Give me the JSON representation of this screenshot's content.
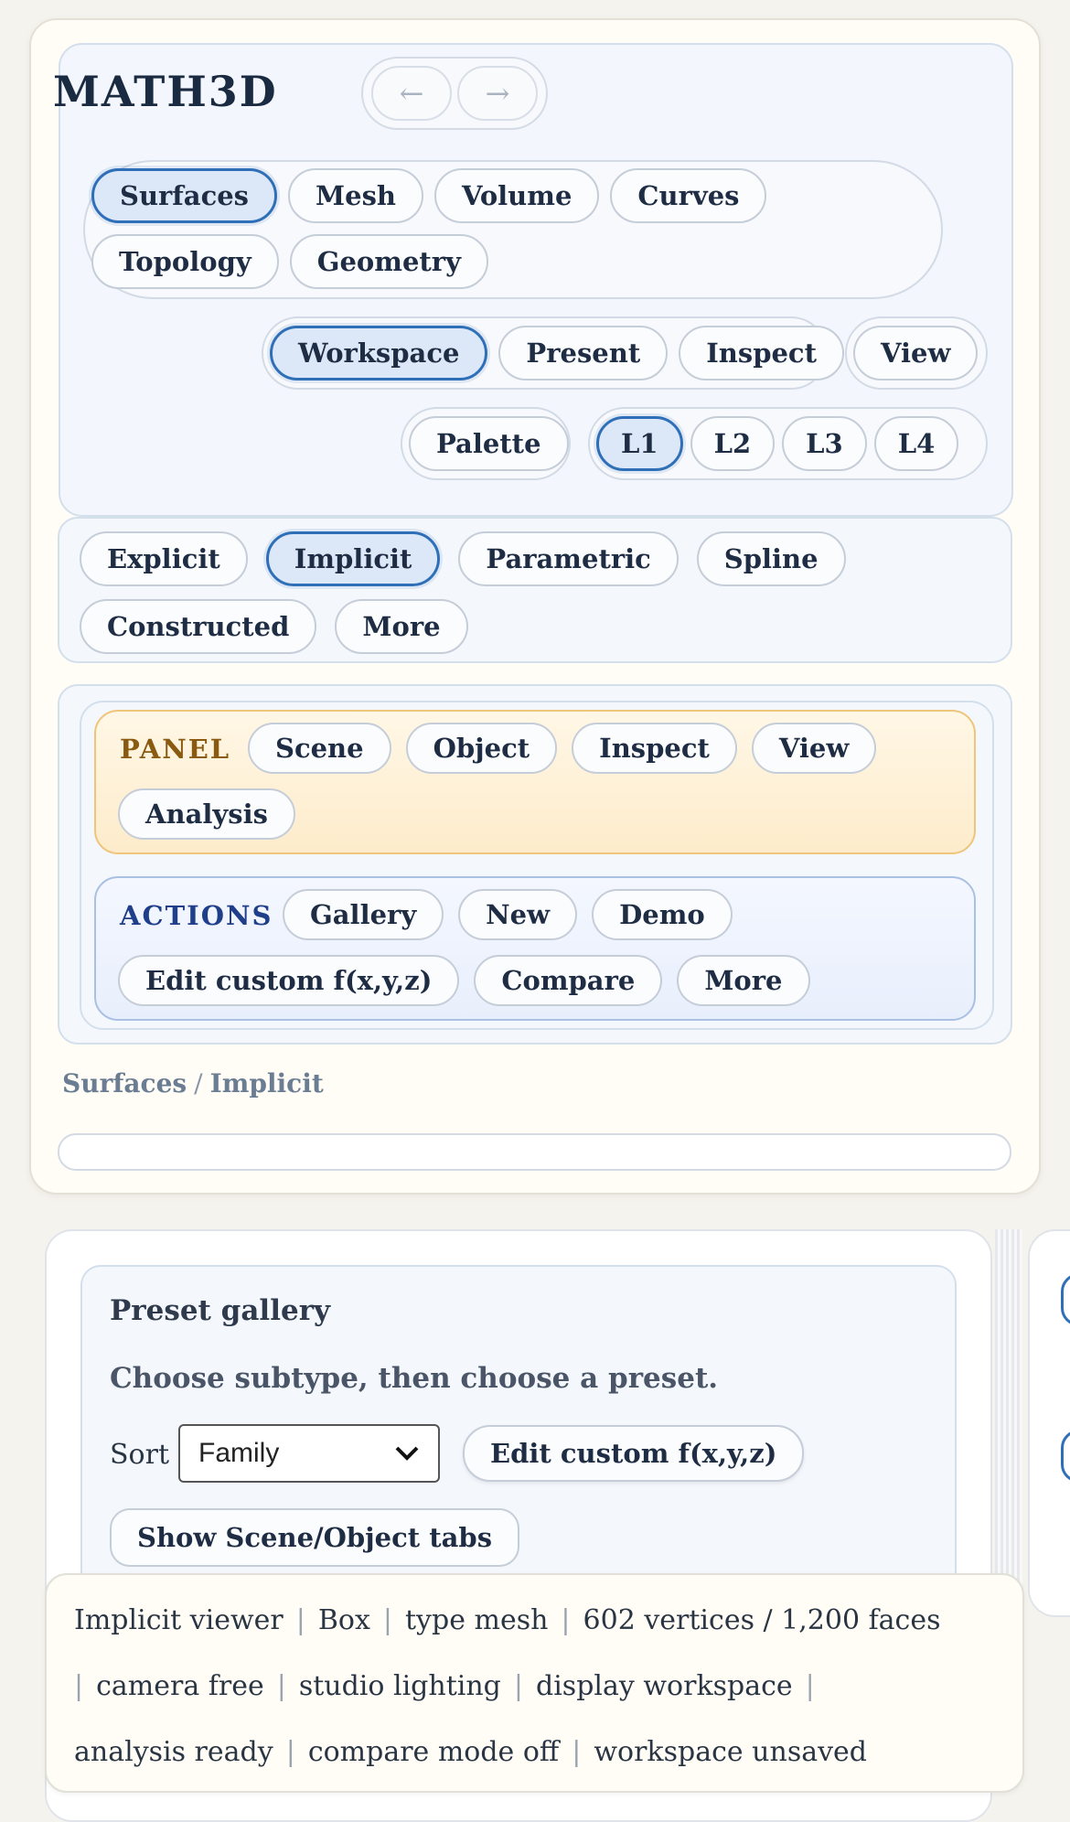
{
  "app": {
    "title": "MATH3D"
  },
  "history": {
    "back_label": "←",
    "forward_label": "→"
  },
  "nav": {
    "main_tabs": [
      "Surfaces",
      "Mesh",
      "Volume",
      "Curves",
      "Topology",
      "Geometry"
    ],
    "active_main_tab": "Surfaces",
    "modes": [
      "Workspace",
      "Present",
      "Inspect"
    ],
    "active_mode": "Workspace",
    "view_label": "View",
    "palette_label": "Palette",
    "levels": [
      "L1",
      "L2",
      "L3",
      "L4"
    ],
    "active_level": "L1"
  },
  "subtypes": {
    "items": [
      "Explicit",
      "Implicit",
      "Parametric",
      "Spline",
      "Constructed",
      "More"
    ],
    "active": "Implicit"
  },
  "panel": {
    "label": "PANEL",
    "tabs": [
      "Scene",
      "Object",
      "Inspect",
      "View",
      "Analysis"
    ]
  },
  "actions": {
    "label": "ACTIONS",
    "buttons": [
      "Gallery",
      "New",
      "Demo",
      "Edit custom f(x,y,z)",
      "Compare",
      "More"
    ]
  },
  "breadcrumb": {
    "section": "Surfaces",
    "separator": "/",
    "subtype": "Implicit"
  },
  "gallery": {
    "title": "Preset gallery",
    "hint": "Choose subtype, then choose a preset.",
    "sort_label": "Sort",
    "sort_value": "Family",
    "edit_button": "Edit custom f(x,y,z)",
    "show_tabs_button": "Show Scene/Object tabs"
  },
  "status": {
    "items": [
      "Implicit viewer",
      "Box",
      "type mesh",
      "602 vertices / 1,200 faces",
      "camera free",
      "studio lighting",
      "display workspace",
      "analysis ready",
      "compare mode off",
      "workspace unsaved"
    ]
  },
  "colors": {
    "accent": "#2f6fb8",
    "panel_label": "#8a5a10",
    "actions_label": "#1f3f8a",
    "breadcrumb": "#6b7d93"
  }
}
